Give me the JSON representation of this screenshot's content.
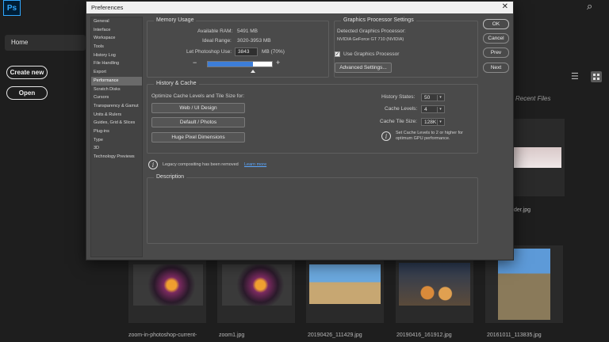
{
  "app": {
    "logo": "Ps"
  },
  "home": {
    "nav_home": "Home",
    "create_new": "Create new",
    "open": "Open",
    "recent_label": "Recent Files",
    "side_file_suffix": "der.jpg",
    "thumbnails": [
      {
        "name": "zoom-in-photoshop-current-"
      },
      {
        "name": "zoom1.jpg"
      },
      {
        "name": "20190426_111429.jpg"
      },
      {
        "name": "20190416_161912.jpg"
      },
      {
        "name": "20161011_113835.jpg"
      }
    ]
  },
  "dialog": {
    "title": "Preferences",
    "nav_items": [
      "General",
      "Interface",
      "Workspace",
      "Tools",
      "History Log",
      "File Handling",
      "Export",
      "Performance",
      "Scratch Disks",
      "Cursors",
      "Transparency & Gamut",
      "Units & Rulers",
      "Guides, Grid & Slices",
      "Plug-ins",
      "Type",
      "3D",
      "Technology Previews"
    ],
    "active_nav_index": 7,
    "memory": {
      "title": "Memory Usage",
      "available_label": "Available RAM:",
      "available_value": "5491 MB",
      "ideal_label": "Ideal Range:",
      "ideal_value": "3020-3953 MB",
      "let_label": "Let Photoshop Use:",
      "let_value": "3843",
      "let_unit": "MB (70%)",
      "slider_fraction": 0.7,
      "minus": "−",
      "plus": "+"
    },
    "gpu": {
      "title": "Graphics Processor Settings",
      "detected_label": "Detected Graphics Processor:",
      "detected_value": "NVIDIA GeForce GT 710 (NVIDIA)",
      "use_gpu_label": "Use Graphics Processor",
      "use_gpu_checked": true,
      "check_mark": "✓",
      "advanced_button": "Advanced Settings..."
    },
    "history": {
      "title": "History & Cache",
      "optimize_label": "Optimize Cache Levels and Tile Size for:",
      "buttons": [
        "Web / UI Design",
        "Default / Photos",
        "Huge Pixel Dimensions"
      ],
      "history_states_label": "History States:",
      "history_states_value": "50",
      "cache_levels_label": "Cache Levels:",
      "cache_levels_value": "4",
      "tile_size_label": "Cache Tile Size:",
      "tile_size_value": "128K",
      "info_text_line1": "Set Cache Levels to 2 or higher for",
      "info_text_line2": "optimum GPU performance."
    },
    "legacy": {
      "text": "Legacy compositing has been removed",
      "link": "Learn more"
    },
    "description": {
      "title": "Description"
    },
    "side_buttons": {
      "ok": "OK",
      "cancel": "Cancel",
      "prev": "Prev",
      "next": "Next"
    }
  }
}
